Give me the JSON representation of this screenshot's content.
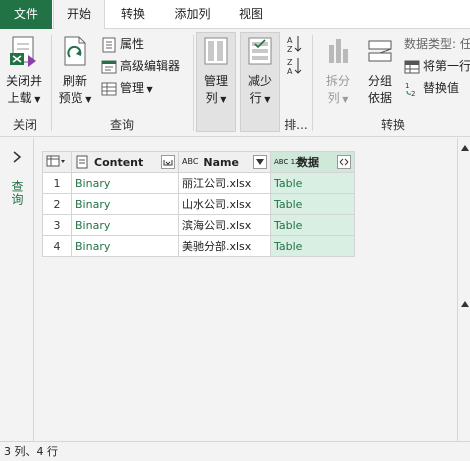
{
  "tabs": [
    {
      "label": "文件"
    },
    {
      "label": "开始"
    },
    {
      "label": "转换"
    },
    {
      "label": "添加列"
    },
    {
      "label": "视图"
    }
  ],
  "ribbon": {
    "close_group": {
      "button_line1": "关闭并",
      "button_line2": "上载",
      "label": "关闭"
    },
    "query_group": {
      "refresh_line1": "刷新",
      "refresh_line2": "预览",
      "properties": "属性",
      "advanced_editor": "高级编辑器",
      "manage": "管理",
      "label": "查询"
    },
    "columns_group": {
      "manage_cols_line1": "管理",
      "manage_cols_line2": "列"
    },
    "rows_group": {
      "reduce_rows_line1": "减少",
      "reduce_rows_line2": "行"
    },
    "sort_group": {
      "label": "排..."
    },
    "transform_group": {
      "split_line1": "拆分",
      "split_line2": "列",
      "group_line1": "分组",
      "group_line2": "依据",
      "data_type": "数据类型: 任",
      "first_row_header": "将第一行",
      "replace_values": "替换值",
      "label": "转换"
    }
  },
  "sidebar": {
    "label": "查询"
  },
  "grid": {
    "columns": [
      {
        "type_label": "",
        "name": "Content"
      },
      {
        "type_label": "ABC",
        "name": "Name"
      },
      {
        "type_label": "ABC 123",
        "name": "数据"
      }
    ],
    "rows": [
      {
        "num": "1",
        "content": "Binary",
        "name": "丽江公司.xlsx",
        "data": "Table"
      },
      {
        "num": "2",
        "content": "Binary",
        "name": "山水公司.xlsx",
        "data": "Table"
      },
      {
        "num": "3",
        "content": "Binary",
        "name": "滨海公司.xlsx",
        "data": "Table"
      },
      {
        "num": "4",
        "content": "Binary",
        "name": "美驰分部.xlsx",
        "data": "Table"
      }
    ]
  },
  "status": {
    "text": "3 列、4 行"
  },
  "colors": {
    "accent": "#217346",
    "selected_column": "#d9efe3"
  }
}
